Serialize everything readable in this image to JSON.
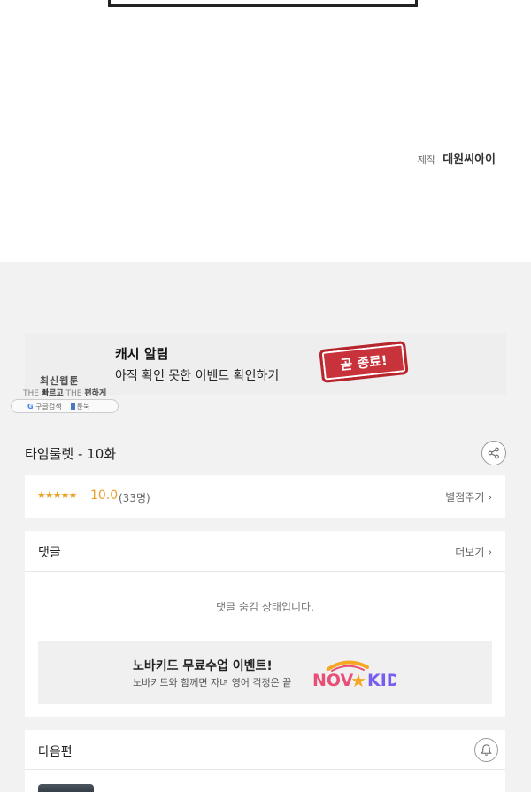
{
  "credit": {
    "label": "제작",
    "value": "대원씨아이"
  },
  "ad": {
    "title": "캐시 알림",
    "subtitle": "아직 확인 못한 이벤트 확인하기",
    "stamp_text": "곧 종료!"
  },
  "watermark": {
    "line1": "최신웹툰",
    "line2_a": "THE",
    "line2_b": "빠르고",
    "line2_c": "THE",
    "line2_d": "편하게",
    "search_label": "구글검색",
    "site_label": "툰북"
  },
  "episode": {
    "title": "타임룰렛 - 10화"
  },
  "rating": {
    "stars": "★★★★★",
    "score": "10.0",
    "count": "(33명)",
    "rate_label": "별점주기 ›"
  },
  "comments": {
    "title": "댓글",
    "more_label": "더보기 ›",
    "hidden_text": "댓글 숨김 상태입니다."
  },
  "promo": {
    "title": "노바키드 무료수업 이벤트!",
    "subtitle": "노바키드와 함께면 자녀 영어 걱정은 끝",
    "logo_text": "NOVAKID"
  },
  "next": {
    "title": "다음편"
  },
  "icons": {
    "share": "share-icon",
    "bell": "bell-icon",
    "chevron": "chevron-right-icon"
  },
  "colors": {
    "rating": "#e9a02a",
    "stamp": "#c8323a",
    "background": "#f2f2f2"
  }
}
